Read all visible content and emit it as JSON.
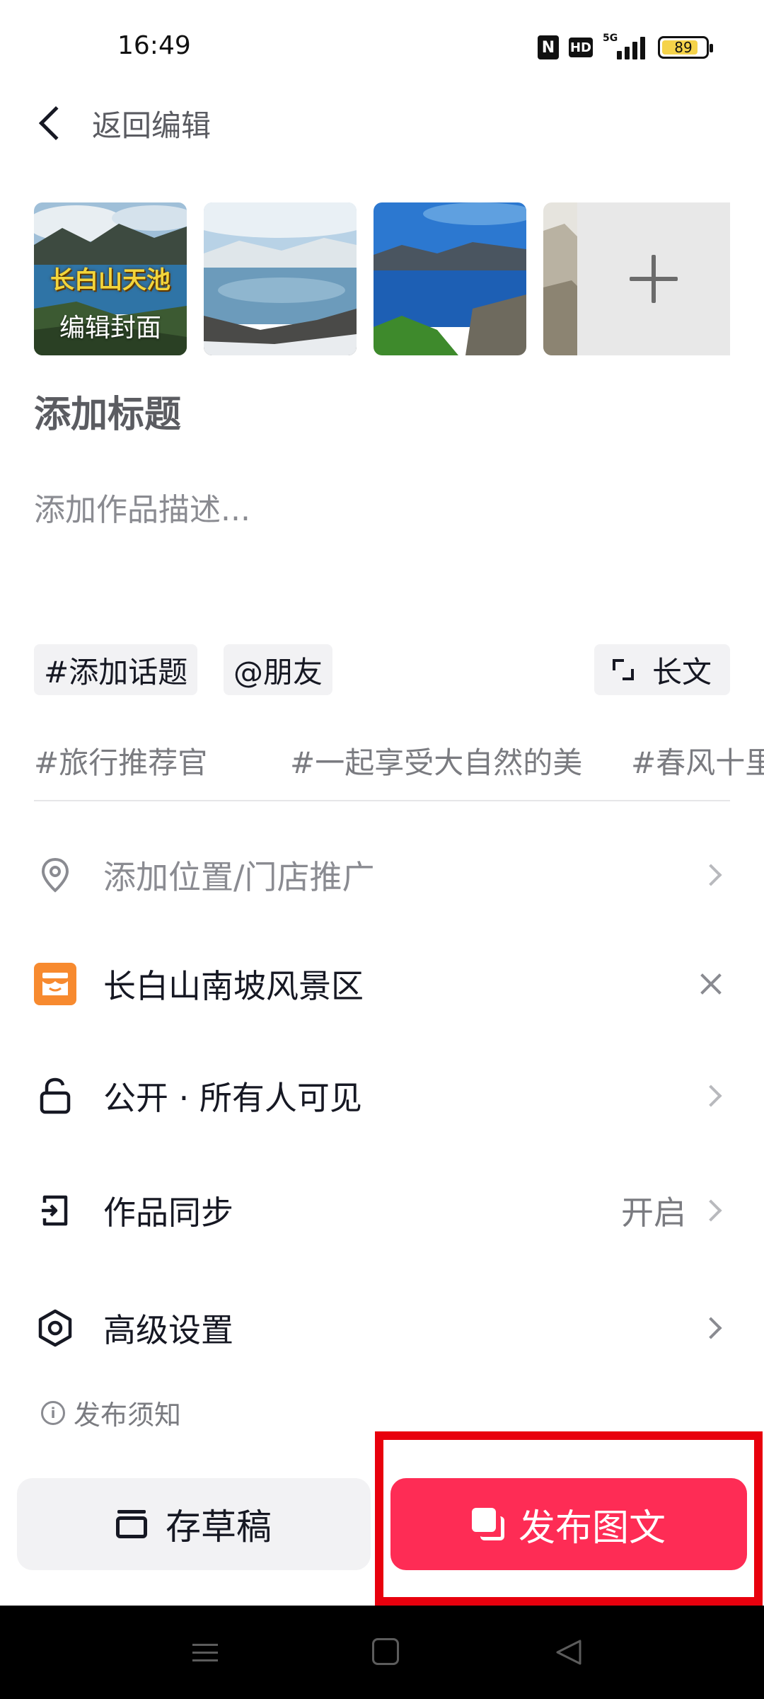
{
  "status_bar": {
    "time": "16:49",
    "nfc": "N",
    "hd": "HD",
    "network": "5G",
    "battery": "89"
  },
  "header": {
    "back_label": "返回编辑"
  },
  "media": {
    "cover_title": "长白山天池",
    "cover_edit_label": "编辑封面"
  },
  "form": {
    "title_placeholder": "添加标题",
    "description_placeholder": "添加作品描述..."
  },
  "chips": {
    "topic": "#添加话题",
    "friend": "@朋友",
    "long_text": "长文"
  },
  "suggested_topics": [
    "#旅行推荐官",
    "#一起享受大自然的美",
    "#春风十里"
  ],
  "settings": {
    "location_label": "添加位置/门店推广",
    "store_label": "长白山南坡风景区",
    "visibility_label": "公开 · 所有人可见",
    "sync_label": "作品同步",
    "sync_value": "开启",
    "advanced_label": "高级设置"
  },
  "notice_label": "发布须知",
  "actions": {
    "draft_label": "存草稿",
    "publish_label": "发布图文"
  },
  "colors": {
    "accent": "#fe2c55",
    "highlight": "#e8000d",
    "store_icon": "#f78a2f"
  }
}
